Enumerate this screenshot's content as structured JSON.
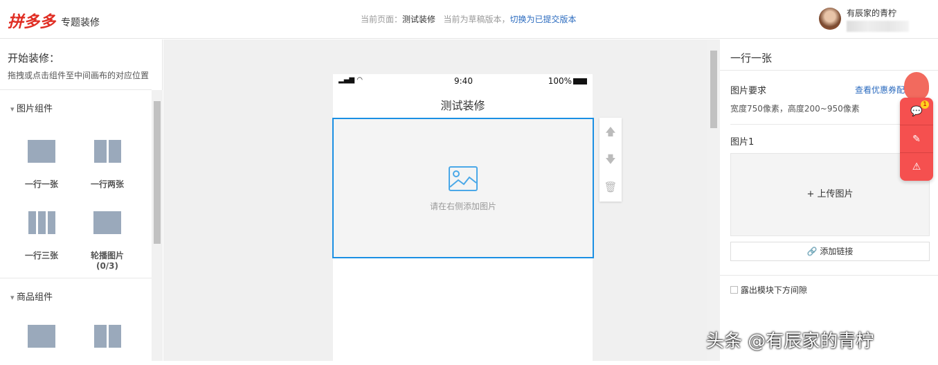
{
  "header": {
    "logo": "拼多多",
    "subtitle": "专题装修",
    "current_page_label": "当前页面：",
    "current_page": "测试装修",
    "draft_note": "当前为草稿版本，",
    "switch_link": "切换为已提交版本",
    "username": "有辰家的青柠"
  },
  "left": {
    "title": "开始装修：",
    "hint": "拖拽或点击组件至中间画布的对应位置",
    "sections": [
      {
        "label": "图片组件",
        "items": [
          "一行一张",
          "一行两张",
          "一行三张",
          "轮播图片(0/3)"
        ]
      },
      {
        "label": "商品组件"
      }
    ]
  },
  "phone": {
    "time": "9:40",
    "battery": "100%",
    "title": "测试装修",
    "placeholder": "请在右侧添加图片"
  },
  "right": {
    "title": "一行一张",
    "req_label": "图片要求",
    "coupon_link": "查看优惠券配置",
    "req_text": "宽度750像素，高度200~950像素",
    "image_label": "图片1",
    "upload": "+ 上传图片",
    "add_link": "添加链接",
    "gap_option": "露出模块下方间隙"
  },
  "float": {
    "badge": "1"
  },
  "watermark": "头条 @有辰家的青柠"
}
